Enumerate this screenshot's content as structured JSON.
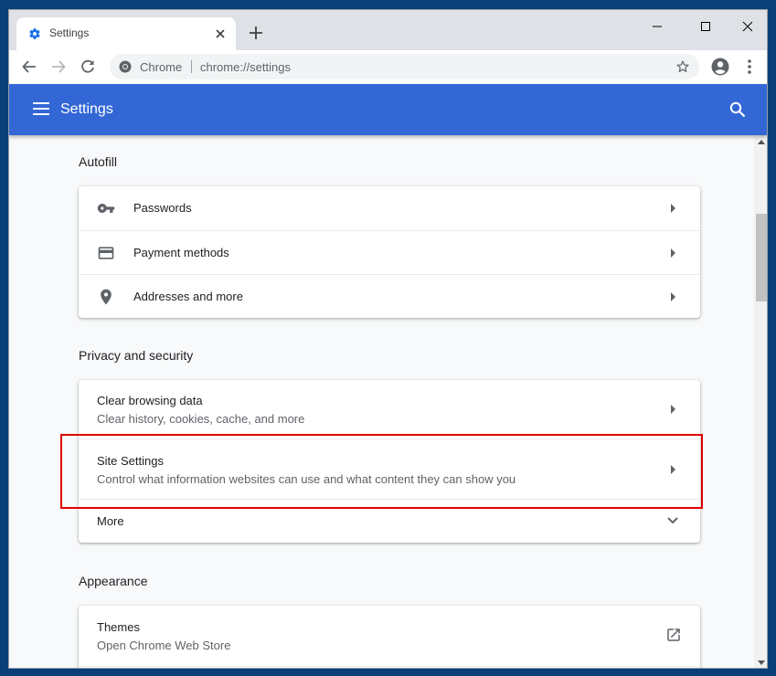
{
  "tab": {
    "title": "Settings"
  },
  "omnibox": {
    "site_label": "Chrome",
    "url": "chrome://settings"
  },
  "header": {
    "title": "Settings"
  },
  "sections": {
    "autofill": {
      "title": "Autofill",
      "items": [
        {
          "label": "Passwords",
          "icon": "key-icon"
        },
        {
          "label": "Payment methods",
          "icon": "credit-card-icon"
        },
        {
          "label": "Addresses and more",
          "icon": "location-pin-icon"
        }
      ]
    },
    "privacy": {
      "title": "Privacy and security",
      "items": [
        {
          "label": "Clear browsing data",
          "sublabel": "Clear history, cookies, cache, and more"
        },
        {
          "label": "Site Settings",
          "sublabel": "Control what information websites can use and what content they can show you"
        }
      ],
      "more_label": "More"
    },
    "appearance": {
      "title": "Appearance",
      "items": [
        {
          "label": "Themes",
          "sublabel": "Open Chrome Web Store",
          "icon": "open-in-new-icon"
        }
      ]
    }
  },
  "colors": {
    "header_bg": "#3367d6",
    "highlight": "#e00000",
    "content_bg": "#f8f9fa"
  }
}
